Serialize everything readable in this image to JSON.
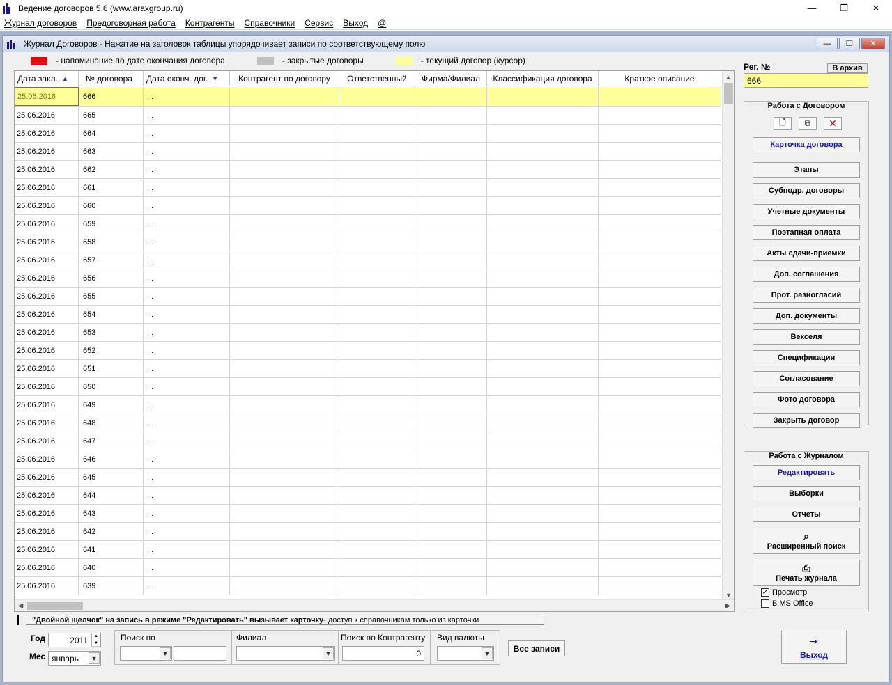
{
  "window": {
    "title": "Ведение договоров 5.6 (www.araxgroup.ru)",
    "minimize": "—",
    "maximize": "❐",
    "close": "✕"
  },
  "menu": [
    "Журнал договоров",
    "Предоговорная работа",
    "Контрагенты",
    "Справочники",
    "Сервис",
    "Выход",
    "@"
  ],
  "child": {
    "title": "Журнал Договоров   -   Нажатие на заголовок таблицы упорядочивает записи по соответствующему полю",
    "min": "—",
    "restore": "❐",
    "close": "✕"
  },
  "legend": {
    "red_color": "#e01010",
    "red_text": "- напоминание по дате окончания договора",
    "gray_color": "#c0c0c0",
    "gray_text": "- закрытые договоры",
    "yellow_color": "#ffff99",
    "yellow_text": "- текущий договор (курсор)"
  },
  "grid": {
    "columns": [
      "Дата закл.",
      "№ договора",
      "Дата оконч. дог.",
      "Контрагент по договору",
      "Ответственный",
      "Фирма/Филиал",
      "Классификация договора",
      "Краткое описание"
    ],
    "sort_up": "▲",
    "sort_down": "▼",
    "rows": [
      [
        "25.06.2016",
        "666",
        ". ."
      ],
      [
        "25.06.2016",
        "665",
        ". ."
      ],
      [
        "25.06.2016",
        "664",
        ". ."
      ],
      [
        "25.06.2016",
        "663",
        ". ."
      ],
      [
        "25.06.2016",
        "662",
        ". ."
      ],
      [
        "25.06.2016",
        "661",
        ". ."
      ],
      [
        "25.06.2016",
        "660",
        ". ."
      ],
      [
        "25.06.2016",
        "659",
        ". ."
      ],
      [
        "25.06.2016",
        "658",
        ". ."
      ],
      [
        "25.06.2016",
        "657",
        ". ."
      ],
      [
        "25.06.2016",
        "656",
        ". ."
      ],
      [
        "25.06.2016",
        "655",
        ". ."
      ],
      [
        "25.06.2016",
        "654",
        ". ."
      ],
      [
        "25.06.2016",
        "653",
        ". ."
      ],
      [
        "25.06.2016",
        "652",
        ". ."
      ],
      [
        "25.06.2016",
        "651",
        ". ."
      ],
      [
        "25.06.2016",
        "650",
        ". ."
      ],
      [
        "25.06.2016",
        "649",
        ". ."
      ],
      [
        "25.06.2016",
        "648",
        ". ."
      ],
      [
        "25.06.2016",
        "647",
        ". ."
      ],
      [
        "25.06.2016",
        "646",
        ". ."
      ],
      [
        "25.06.2016",
        "645",
        ". ."
      ],
      [
        "25.06.2016",
        "644",
        ". ."
      ],
      [
        "25.06.2016",
        "643",
        ". ."
      ],
      [
        "25.06.2016",
        "642",
        ". ."
      ],
      [
        "25.06.2016",
        "641",
        ". ."
      ],
      [
        "25.06.2016",
        "640",
        ". ."
      ],
      [
        "25.06.2016",
        "639",
        ". ."
      ]
    ]
  },
  "hint": {
    "bold": "\"Двойной щелчок\" на запись в режиме \"Редактировать\" вызывает карточку",
    "rest": "  -  доступ к справочникам только из карточки"
  },
  "right": {
    "reg_label": "Рег. №",
    "archive": "В архив",
    "reg_value": "666",
    "group1_title": "Работа с Договором",
    "card": "Карточка договора",
    "buttons1": [
      "Этапы",
      "Субподр. договоры",
      "Учетные документы",
      "Поэтапная оплата",
      "Акты сдачи-приемки",
      "Доп. соглашения",
      "Прот. разногласий",
      "Доп. документы",
      "Векселя",
      "Спецификации",
      "Согласование",
      "Фото договора",
      "Закрыть договор"
    ],
    "group2_title": "Работа с Журналом",
    "edit": "Редактировать",
    "selections": "Выборки",
    "reports": "Отчеты",
    "adv_search": "Расширенный поиск",
    "print": "Печать журнала",
    "preview": "Просмотр",
    "ms_office": "В MS Office"
  },
  "filters": {
    "year_label": "Год",
    "year_value": "2011",
    "month_label": "Мес",
    "month_value": "январь",
    "search_by_label": "Поиск по",
    "branch_label": "Филиал",
    "counterparty_label": "Поиск по Контрагенту",
    "counterparty_value": "0",
    "currency_label": "Вид валюты",
    "all_records": "Все записи",
    "exit": "Выход"
  }
}
